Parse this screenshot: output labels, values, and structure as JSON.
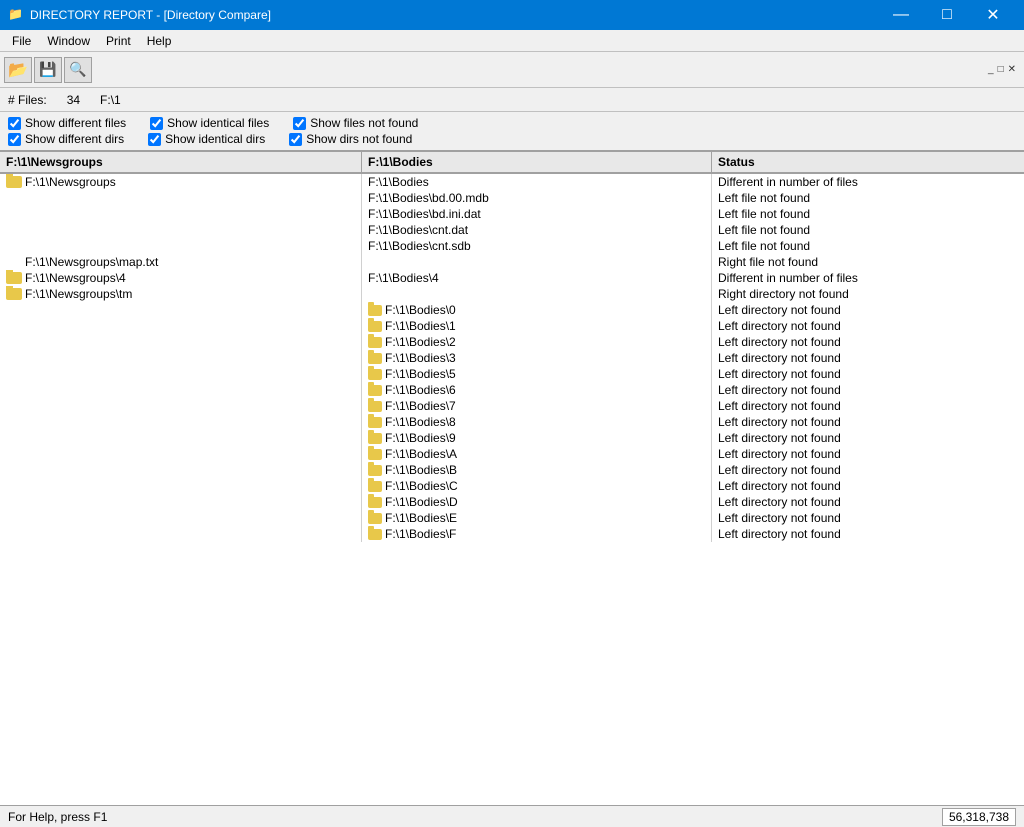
{
  "titleBar": {
    "icon": "📁",
    "text": "DIRECTORY REPORT - [Directory Compare]",
    "minimize": "—",
    "maximize": "□",
    "close": "✕"
  },
  "menuBar": {
    "items": [
      "File",
      "Window",
      "Print",
      "Help"
    ]
  },
  "stats": {
    "filesLabel": "# Files:",
    "filesCount": "34",
    "path": "F:\\1"
  },
  "checkboxes": {
    "showDifferentFiles": true,
    "showDifferentFilesLabel": "Show different files",
    "showIdenticalFiles": true,
    "showIdenticalFilesLabel": "Show identical files",
    "showFilesNotFound": true,
    "showFilesNotFoundLabel": "Show files not found",
    "showDifferentDirs": true,
    "showDifferentDirsLabel": "Show different dirs",
    "showIdenticalDirs": true,
    "showIdenticalDirsLabel": "Show identical dirs",
    "showDirsNotFound": true,
    "showDirsNotFoundLabel": "Show dirs not found"
  },
  "tableHeaders": {
    "col1": "F:\\1\\Newsgroups",
    "col2": "F:\\1\\Bodies",
    "col3": "Status"
  },
  "rows": [
    {
      "left": "F:\\1\\Newsgroups",
      "mid": "F:\\1\\Bodies",
      "status": "Different in number of files",
      "leftFolder": true,
      "midFolder": false
    },
    {
      "left": "",
      "mid": "F:\\1\\Bodies\\bd.00.mdb",
      "status": "Left file not found",
      "leftFolder": false,
      "midFolder": false
    },
    {
      "left": "",
      "mid": "F:\\1\\Bodies\\bd.ini.dat",
      "status": "Left file not found",
      "leftFolder": false,
      "midFolder": false
    },
    {
      "left": "",
      "mid": "F:\\1\\Bodies\\cnt.dat",
      "status": "Left file not found",
      "leftFolder": false,
      "midFolder": false
    },
    {
      "left": "",
      "mid": "F:\\1\\Bodies\\cnt.sdb",
      "status": "Left file not found",
      "leftFolder": false,
      "midFolder": false
    },
    {
      "left": "F:\\1\\Newsgroups\\map.txt",
      "mid": "",
      "status": "Right file not found",
      "leftFolder": false,
      "midFolder": false
    },
    {
      "left": "F:\\1\\Newsgroups\\4",
      "mid": "F:\\1\\Bodies\\4",
      "status": "Different in number of files",
      "leftFolder": true,
      "midFolder": false
    },
    {
      "left": "F:\\1\\Newsgroups\\tm",
      "mid": "",
      "status": "Right directory not found",
      "leftFolder": true,
      "midFolder": false
    },
    {
      "left": "",
      "mid": "F:\\1\\Bodies\\0",
      "status": "Left directory not found",
      "leftFolder": false,
      "midFolder": true
    },
    {
      "left": "",
      "mid": "F:\\1\\Bodies\\1",
      "status": "Left directory not found",
      "leftFolder": false,
      "midFolder": true
    },
    {
      "left": "",
      "mid": "F:\\1\\Bodies\\2",
      "status": "Left directory not found",
      "leftFolder": false,
      "midFolder": true
    },
    {
      "left": "",
      "mid": "F:\\1\\Bodies\\3",
      "status": "Left directory not found",
      "leftFolder": false,
      "midFolder": true
    },
    {
      "left": "",
      "mid": "F:\\1\\Bodies\\5",
      "status": "Left directory not found",
      "leftFolder": false,
      "midFolder": true
    },
    {
      "left": "",
      "mid": "F:\\1\\Bodies\\6",
      "status": "Left directory not found",
      "leftFolder": false,
      "midFolder": true
    },
    {
      "left": "",
      "mid": "F:\\1\\Bodies\\7",
      "status": "Left directory not found",
      "leftFolder": false,
      "midFolder": true
    },
    {
      "left": "",
      "mid": "F:\\1\\Bodies\\8",
      "status": "Left directory not found",
      "leftFolder": false,
      "midFolder": true
    },
    {
      "left": "",
      "mid": "F:\\1\\Bodies\\9",
      "status": "Left directory not found",
      "leftFolder": false,
      "midFolder": true
    },
    {
      "left": "",
      "mid": "F:\\1\\Bodies\\A",
      "status": "Left directory not found",
      "leftFolder": false,
      "midFolder": true
    },
    {
      "left": "",
      "mid": "F:\\1\\Bodies\\B",
      "status": "Left directory not found",
      "leftFolder": false,
      "midFolder": true
    },
    {
      "left": "",
      "mid": "F:\\1\\Bodies\\C",
      "status": "Left directory not found",
      "leftFolder": false,
      "midFolder": true
    },
    {
      "left": "",
      "mid": "F:\\1\\Bodies\\D",
      "status": "Left directory not found",
      "leftFolder": false,
      "midFolder": true
    },
    {
      "left": "",
      "mid": "F:\\1\\Bodies\\E",
      "status": "Left directory not found",
      "leftFolder": false,
      "midFolder": true
    },
    {
      "left": "",
      "mid": "F:\\1\\Bodies\\F",
      "status": "Left directory not found",
      "leftFolder": false,
      "midFolder": true
    }
  ],
  "statusBar": {
    "helpText": "For Help, press F1",
    "coords": "56,318,738"
  }
}
